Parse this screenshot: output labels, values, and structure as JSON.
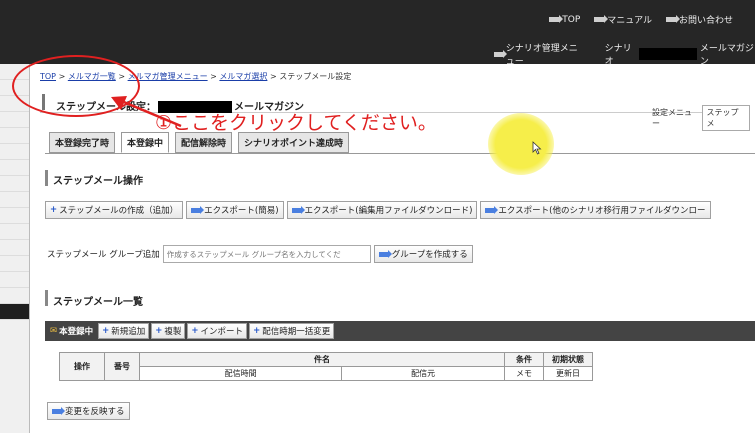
{
  "header": {
    "top_links": [
      "TOP",
      "マニュアル",
      "お問い合わせ"
    ],
    "scenario_menu": "シナリオ管理メニュー",
    "scenario_label": "シナリオ",
    "scenario_suffix": "メールマガジン"
  },
  "breadcrumb": {
    "items": [
      "TOP",
      "メルマガ一覧",
      "メルマガ管理メニュー",
      "メルマガ選択"
    ],
    "separator": ">",
    "current": "ステップメール設定"
  },
  "page": {
    "title_prefix": "ステップメール設定：",
    "title_suffix": "メールマガジン",
    "setting_menu_label": "設定メニュー",
    "setting_menu_value": "ステップメ"
  },
  "tabs": [
    "本登録完了時",
    "本登録中",
    "配信解除時",
    "シナリオポイント達成時"
  ],
  "operations": {
    "heading": "ステップメール操作",
    "buttons": [
      "ステップメールの作成（追加）",
      "エクスポート(簡易)",
      "エクスポート(編集用ファイルダウンロード)",
      "エクスポート(他のシナリオ移行用ファイルダウンロー"
    ]
  },
  "group": {
    "label": "ステップメール グループ追加",
    "placeholder": "作成するステップメール グループ名を入力してくだ",
    "button": "グループを作成する"
  },
  "list": {
    "heading": "ステップメール一覧",
    "current_tab": "本登録中",
    "buttons": [
      "新規追加",
      "複製",
      "インポート",
      "配信時期一括変更"
    ],
    "columns": {
      "op": "操作",
      "number": "番号",
      "subject": "件名",
      "send_time": "配信時間",
      "sender": "配信元",
      "condition": "条件",
      "memo": "メモ",
      "initial_status": "初期状態",
      "update_date": "更新日"
    },
    "reflect_button": "変更を反映する"
  },
  "annotation": {
    "text": "①ここをクリックしてください。",
    "color": "#e02020"
  },
  "colors": {
    "topbar": "#262626",
    "accent_blue": "#4a7fe0",
    "highlight": "#f6ee4a"
  }
}
